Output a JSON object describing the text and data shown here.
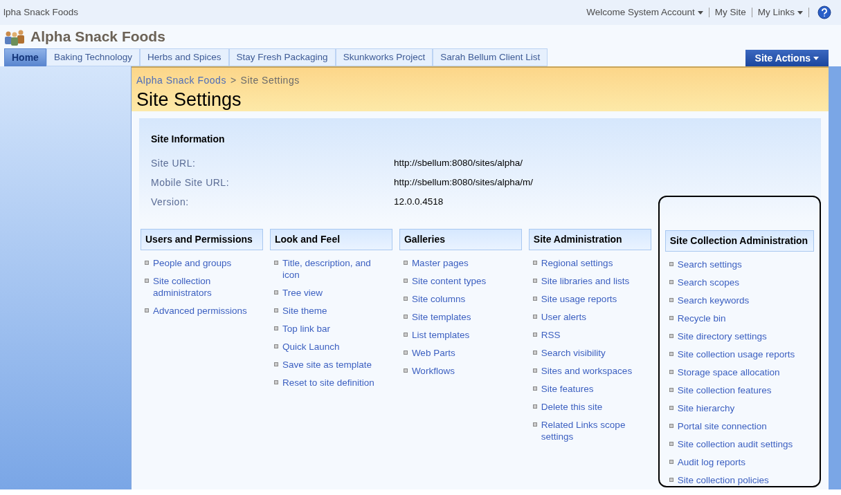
{
  "top_bar": {
    "site_name": "lpha Snack Foods",
    "welcome": "Welcome System Account",
    "links": [
      {
        "label": "My Site",
        "dropdown": false
      },
      {
        "label": "My Links",
        "dropdown": true
      }
    ]
  },
  "site_title": "Alpha Snack Foods",
  "tabs": [
    {
      "label": "Home",
      "selected": true
    },
    {
      "label": "Baking Technology",
      "selected": false
    },
    {
      "label": "Herbs and Spices",
      "selected": false
    },
    {
      "label": "Stay Fresh Packaging",
      "selected": false
    },
    {
      "label": "Skunkworks Project",
      "selected": false
    },
    {
      "label": "Sarah Bellum Client List",
      "selected": false
    }
  ],
  "site_actions": "Site Actions",
  "breadcrumb": {
    "parent": "Alpha Snack Foods",
    "separator": ">",
    "current": "Site Settings"
  },
  "page_title": "Site Settings",
  "site_information": {
    "heading": "Site Information",
    "rows": [
      {
        "label": "Site URL:",
        "value": "http://sbellum:8080/sites/alpha/"
      },
      {
        "label": "Mobile Site URL:",
        "value": "http://sbellum:8080/sites/alpha/m/"
      },
      {
        "label": "Version:",
        "value": "12.0.0.4518"
      }
    ]
  },
  "sections": [
    {
      "heading": "Users and Permissions",
      "highlighted": false,
      "links": [
        "People and groups",
        "Site collection administrators",
        "Advanced permissions"
      ]
    },
    {
      "heading": "Look and Feel",
      "highlighted": false,
      "links": [
        "Title, description, and icon",
        "Tree view",
        "Site theme",
        "Top link bar",
        "Quick Launch",
        "Save site as template",
        "Reset to site definition"
      ]
    },
    {
      "heading": "Galleries",
      "highlighted": false,
      "links": [
        "Master pages",
        "Site content types",
        "Site columns",
        "Site templates",
        "List templates",
        "Web Parts",
        "Workflows"
      ]
    },
    {
      "heading": "Site Administration",
      "highlighted": false,
      "links": [
        "Regional settings",
        "Site libraries and lists",
        "Site usage reports",
        "User alerts",
        "RSS",
        "Search visibility",
        "Sites and workspaces",
        "Site features",
        "Delete this site",
        "Related Links scope settings"
      ]
    },
    {
      "heading": "Site Collection Administration",
      "highlighted": true,
      "links": [
        "Search settings",
        "Search scopes",
        "Search keywords",
        "Recycle bin",
        "Site directory settings",
        "Site collection usage reports",
        "Storage space allocation",
        "Site collection features",
        "Site hierarchy",
        "Portal site connection",
        "Site collection audit settings",
        "Audit log reports",
        "Site collection policies"
      ]
    }
  ]
}
